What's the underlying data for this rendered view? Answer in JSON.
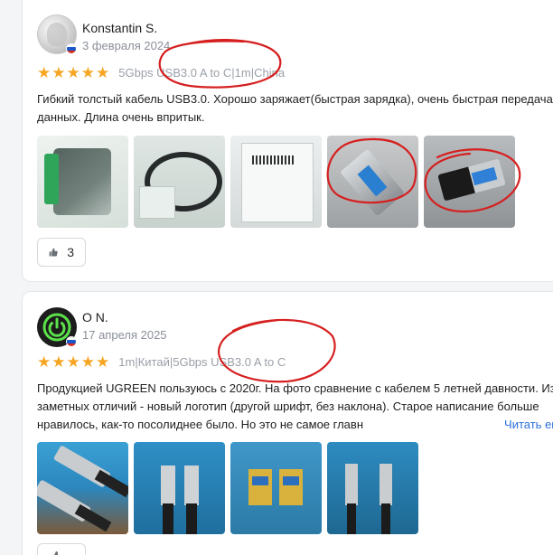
{
  "reviews": [
    {
      "author": "Konstantin S.",
      "date": "3 февраля 2024",
      "rating": 5,
      "meta": [
        "5Gbps USB3.0 A to C",
        "1m",
        "China"
      ],
      "text": "Гибкий толстый кабель USB3.0. Хорошо заряжает(быстрая зарядка), очень быстрая передача данных. Длина очень впритык.",
      "photos": [
        "cable-package",
        "coiled-cable",
        "box-label",
        "usb-a-connector",
        "usb-a-connector-closeup"
      ],
      "likes": "3"
    },
    {
      "author": "O N.",
      "date": "17 апреля 2025",
      "rating": 5,
      "meta": [
        "1m",
        "Китай",
        "5Gbps USB3.0 A to C"
      ],
      "text": "Продукцией UGREEN пользуюсь с 2020г. На фото сравнение с кабелем 5 летней давности. Из заметных отличий - новый логотип (другой шрифт, без наклона). Старое написание больше нравилось, как-то посолиднее было. Но это не самое главн",
      "read_more": "Читать ещ",
      "photos": [
        "usb-cables-wall",
        "usb-a-plugs",
        "old-new-connectors",
        "two-cables-compare"
      ],
      "likes": ""
    }
  ],
  "icons": {
    "star": "★",
    "thumb": "thumbs-up-icon",
    "more": "more-icon"
  },
  "colors": {
    "star": "#f6a623",
    "link": "#2a6fdb",
    "meta": "#9aa0a8",
    "annotation": "#d61f1f"
  }
}
